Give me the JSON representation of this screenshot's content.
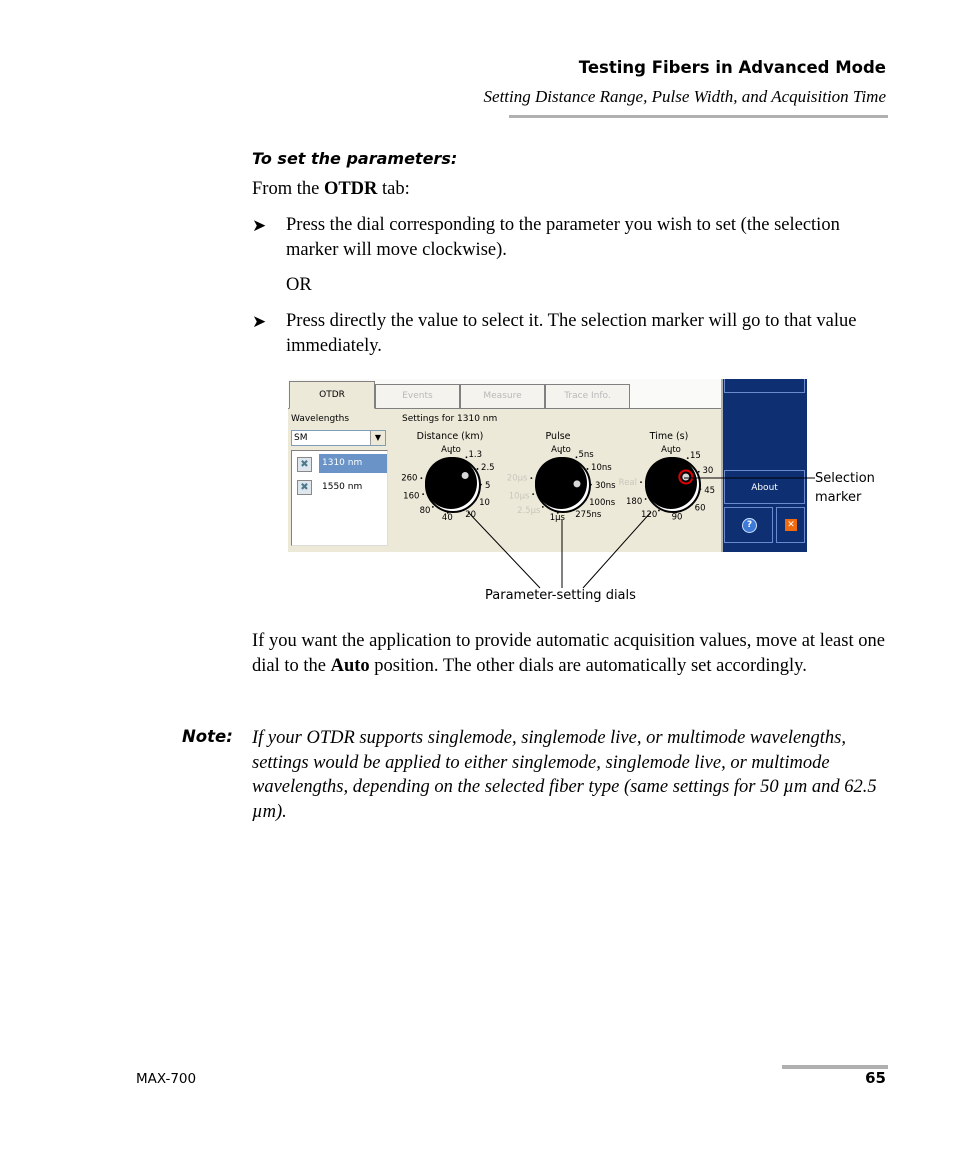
{
  "header": {
    "chapter_title": "Testing Fibers in Advanced Mode",
    "section_title": "Setting Distance Range, Pulse Width, and Acquisition Time"
  },
  "procedure": {
    "title": "To set the parameters:",
    "intro_prefix": "From the ",
    "intro_bold": "OTDR",
    "intro_suffix": " tab:",
    "bullet_glyph": "➤",
    "steps": [
      "Press the dial corresponding to the parameter you wish to set (the selection marker will move clockwise).",
      "Press directly the value to select it. The selection marker will go to that value immediately."
    ],
    "or_text": "OR"
  },
  "screenshot": {
    "tabs": [
      {
        "label": "OTDR",
        "active": true
      },
      {
        "label": "Events",
        "active": false
      },
      {
        "label": "Measure",
        "active": false
      },
      {
        "label": "Trace Info.",
        "active": false
      }
    ],
    "wavelengths_label": "Wavelengths",
    "fiber_type_select": "SM",
    "wavelengths": [
      {
        "label": "1310 nm",
        "selected": true
      },
      {
        "label": "1550 nm",
        "selected": false
      }
    ],
    "settings_label": "Settings for 1310 nm",
    "dials": [
      {
        "title": "Distance (km)",
        "selected": "2.5",
        "positions": [
          {
            "label": "Auto",
            "enabled": true
          },
          {
            "label": "1.3",
            "enabled": true
          },
          {
            "label": "2.5",
            "enabled": true
          },
          {
            "label": "5",
            "enabled": true
          },
          {
            "label": "10",
            "enabled": true
          },
          {
            "label": "20",
            "enabled": true
          },
          {
            "label": "40",
            "enabled": true
          },
          {
            "label": "80",
            "enabled": true
          },
          {
            "label": "160",
            "enabled": true
          },
          {
            "label": "260",
            "enabled": true
          }
        ]
      },
      {
        "title": "Pulse",
        "selected": "30ns",
        "positions": [
          {
            "label": "Auto",
            "enabled": true
          },
          {
            "label": "5ns",
            "enabled": true
          },
          {
            "label": "10ns",
            "enabled": true
          },
          {
            "label": "30ns",
            "enabled": true
          },
          {
            "label": "100ns",
            "enabled": true
          },
          {
            "label": "275ns",
            "enabled": true
          },
          {
            "label": "1µs",
            "enabled": true
          },
          {
            "label": "2.5µs",
            "enabled": false
          },
          {
            "label": "10µs",
            "enabled": false
          },
          {
            "label": "20µs",
            "enabled": false
          }
        ]
      },
      {
        "title": "Time (s)",
        "selected": "30",
        "positions": [
          {
            "label": "Auto",
            "enabled": true
          },
          {
            "label": "15",
            "enabled": true
          },
          {
            "label": "30",
            "enabled": true
          },
          {
            "label": "45",
            "enabled": true
          },
          {
            "label": "60",
            "enabled": true
          },
          {
            "label": "90",
            "enabled": true
          },
          {
            "label": "120",
            "enabled": true
          },
          {
            "label": "180",
            "enabled": true
          },
          {
            "label": "Real",
            "enabled": false
          }
        ]
      }
    ],
    "side_panel": {
      "about_label": "About",
      "help_icon": "?",
      "close_icon": "✕"
    },
    "colors": {
      "panel_blue": "#0f2f73",
      "selection_blue": "#6a94c8",
      "marker_red": "#e00000",
      "close_orange": "#f06a10"
    }
  },
  "callouts": {
    "selection_marker_line1": "Selection",
    "selection_marker_line2": "marker",
    "dials": "Parameter-setting dials"
  },
  "body": {
    "auto_prefix": "If you want the application to provide automatic acquisition values, move at least one dial to the ",
    "auto_bold": "Auto",
    "auto_suffix": " position. The other dials are automatically set accordingly."
  },
  "note": {
    "label": "Note:",
    "text": "If your OTDR supports singlemode, singlemode live, or multimode wavelengths, settings would be applied to either singlemode, singlemode live, or multimode wavelengths, depending on the selected fiber type (same settings for 50 µm and 62.5 µm)."
  },
  "footer": {
    "product": "MAX-700",
    "page_number": "65"
  }
}
